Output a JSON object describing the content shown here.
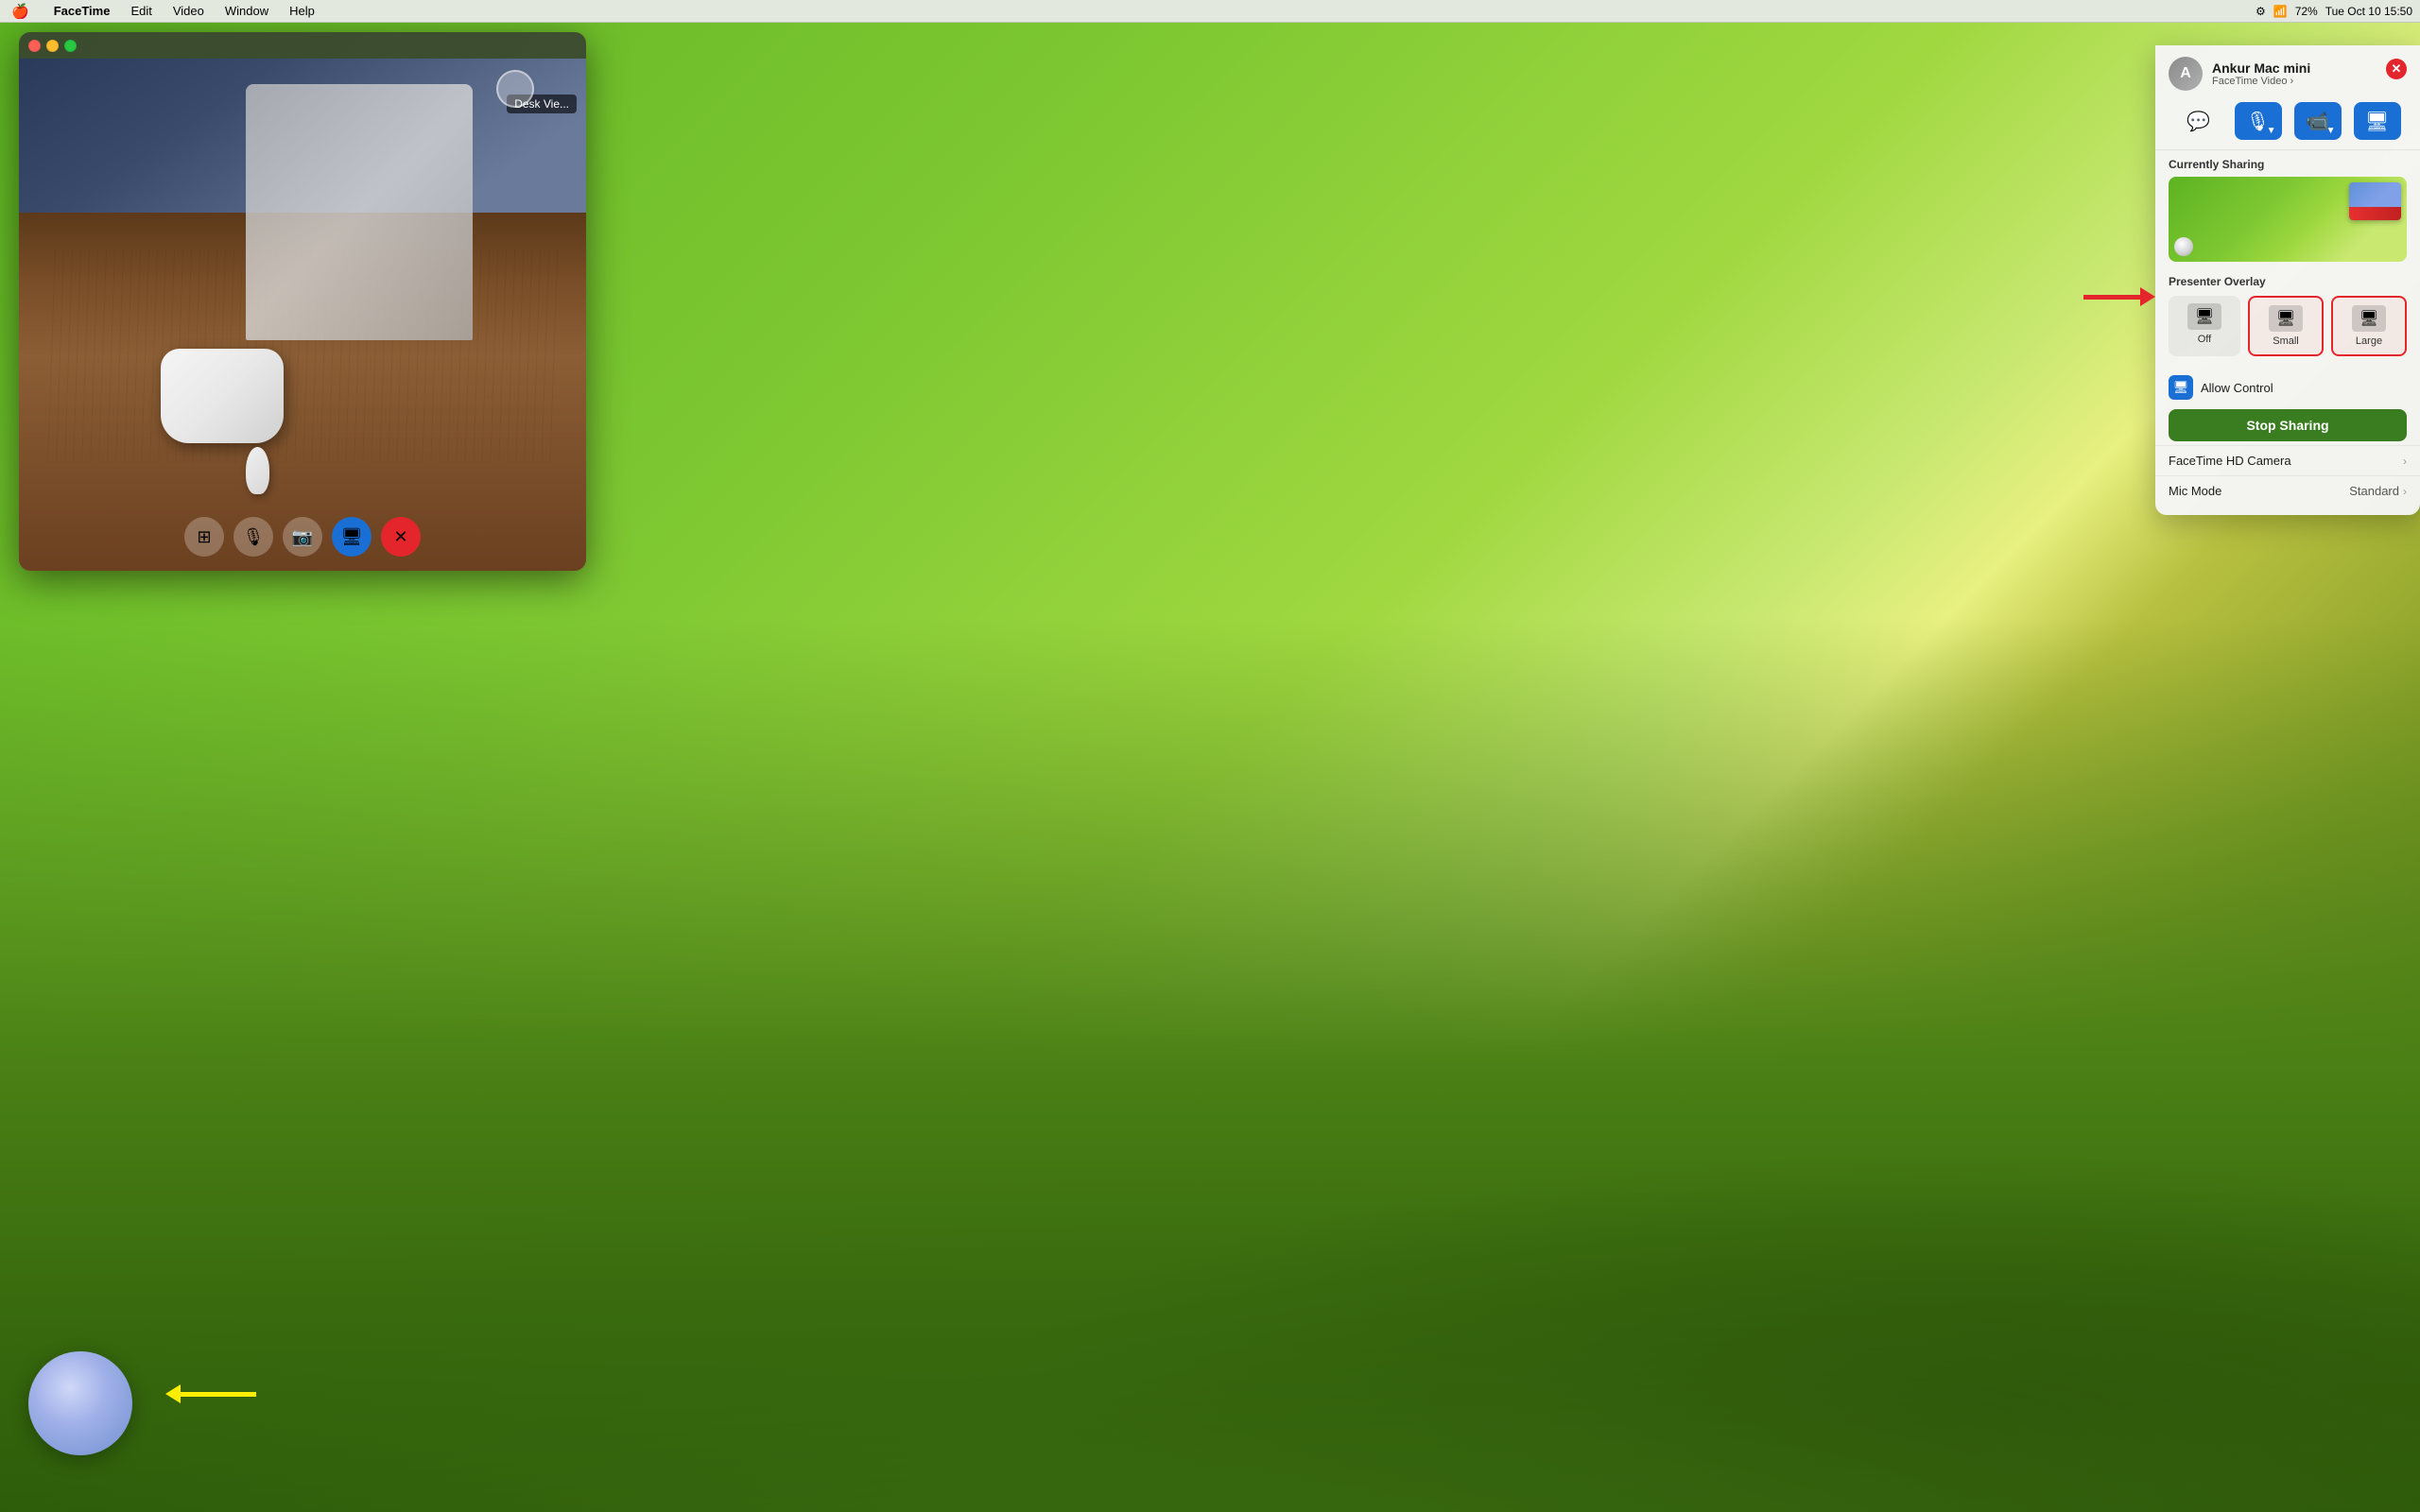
{
  "menubar": {
    "apple": "🍎",
    "app_name": "FaceTime",
    "menus": [
      "Edit",
      "Video",
      "Window",
      "Help"
    ],
    "right": {
      "battery": "72%",
      "time": "Tue Oct 10  15:50"
    }
  },
  "facetime_window": {
    "desk_view_label": "Desk Vie...",
    "controls": {
      "grid_icon": "⊞",
      "mic_icon": "🎤",
      "camera_icon": "📹",
      "share_icon": "🖥",
      "end_icon": "✕"
    }
  },
  "panel": {
    "title": "Ankur Mac mini",
    "subtitle": "FaceTime Video",
    "close_icon": "✕",
    "currently_sharing_label": "Currently Sharing",
    "presenter_overlay_label": "Presenter Overlay",
    "overlay_options": [
      {
        "label": "Off",
        "selected": false
      },
      {
        "label": "Small",
        "selected": true
      },
      {
        "label": "Large",
        "selected": true
      }
    ],
    "allow_control_label": "Allow Control",
    "stop_sharing_label": "Stop Sharing",
    "camera_label": "FaceTime HD Camera",
    "mic_label": "Mic Mode",
    "mic_value": "Standard"
  }
}
